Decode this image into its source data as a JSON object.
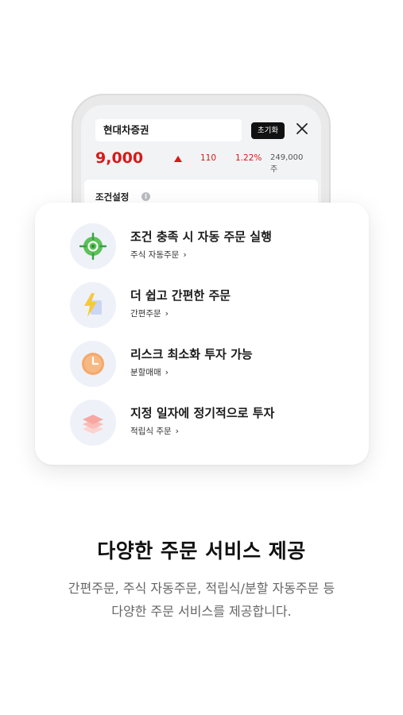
{
  "phone": {
    "stock_name": "현대차증권",
    "reset_label": "초기화",
    "price": "9,000",
    "change": "110",
    "change_pct": "1.22%",
    "volume": "249,000주",
    "condition_label": "조건설정",
    "info_glyph": "i"
  },
  "features": [
    {
      "title": "조건 충족 시 자동 주문 실행",
      "link": "주식 자동주문",
      "icon": "target-icon"
    },
    {
      "title": "더 쉽고 간편한 주문",
      "link": "간편주문",
      "icon": "lightning-icon"
    },
    {
      "title": "리스크 최소화 투자 가능",
      "link": "분할매매",
      "icon": "clock-icon"
    },
    {
      "title": "지정 일자에 정기적으로 투자",
      "link": "적립식 주문",
      "icon": "layers-icon"
    }
  ],
  "chevron": "›",
  "headline": "다양한 주문 서비스 제공",
  "description": {
    "line1": "간편주문, 주식 자동주문, 적립식/분할 자동주문 등",
    "line2": "다양한 주문 서비스를 제공합니다."
  },
  "colors": {
    "up_red": "#d71a1a",
    "target_green": "#5cc15a",
    "lightning_yellow": "#f6c93c",
    "clock_orange": "#f4a96a",
    "layers_pink": "#f7a6a0"
  }
}
